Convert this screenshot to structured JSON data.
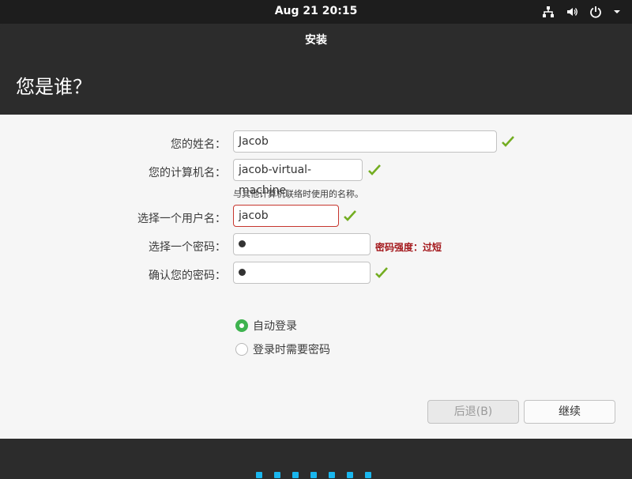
{
  "topbar": {
    "datetime": "Aug 21  20:15",
    "icons": [
      "network-icon",
      "volume-icon",
      "power-icon",
      "menu-arrow-icon"
    ]
  },
  "window": {
    "title": "安装",
    "heading": "您是谁？"
  },
  "form": {
    "name_label": "您的姓名：",
    "name_value": "Jacob",
    "computer_label": "您的计算机名：",
    "computer_value": "jacob-virtual-machine",
    "computer_hint": "与其他计算机联络时使用的名称。",
    "username_label": "选择一个用户名：",
    "username_value": "jacob",
    "password_label": "选择一个密码：",
    "password_strength": "密码强度：过短",
    "confirm_label": "确认您的密码：",
    "autologin_label": "自动登录",
    "require_password_label": "登录时需要密码",
    "autologin_selected": true
  },
  "buttons": {
    "back_label": "后退(B)",
    "continue_label": "继续"
  },
  "colors": {
    "accent_green": "#3eb34f",
    "check_green": "#73ad21",
    "error_red": "#a3171b",
    "pager_blue": "#19b6ee"
  },
  "progress": {
    "steps_shown": 7
  }
}
